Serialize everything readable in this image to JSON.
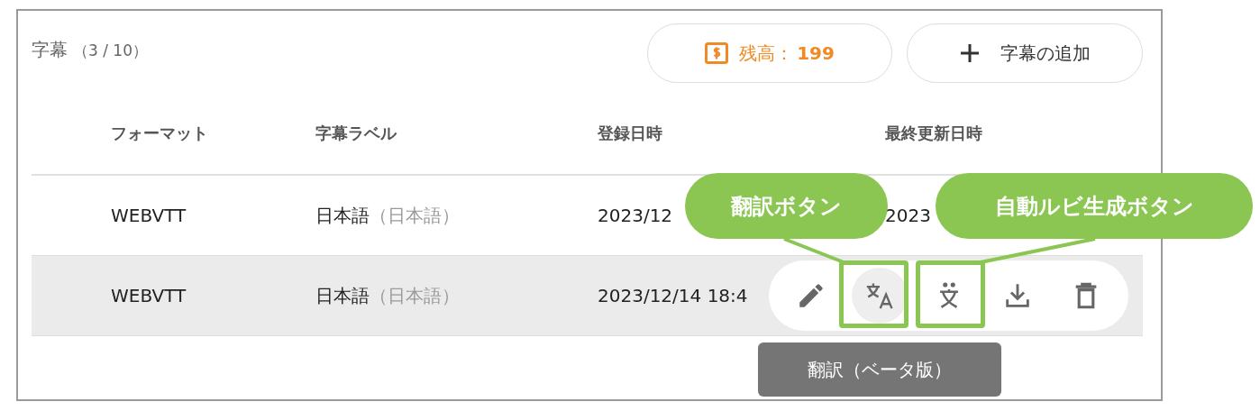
{
  "panel": {
    "title": "字幕",
    "count": "（3 / 10）",
    "balance": {
      "label": "残高：",
      "value": "199"
    },
    "add_button": "字幕の追加"
  },
  "table": {
    "columns": [
      "フォーマット",
      "字幕ラベル",
      "登録日時",
      "最終更新日時"
    ],
    "rows": [
      {
        "format": "WEBVTT",
        "label": "日本語",
        "label_note": "（日本語）",
        "registered": "2023/12",
        "updated": "2023",
        "hovered": false
      },
      {
        "format": "WEBVTT",
        "label": "日本語",
        "label_note": "（日本語）",
        "registered": "2023/12/14 18:4",
        "hovered": true,
        "actions": [
          {
            "kind": "edit",
            "hovered": false
          },
          {
            "kind": "translate",
            "hovered": true
          },
          {
            "kind": "ruby",
            "hovered": false
          },
          {
            "kind": "download",
            "hovered": false
          },
          {
            "kind": "delete",
            "hovered": false
          }
        ],
        "tooltip": "翻訳（ベータ版）"
      }
    ]
  },
  "annotations": [
    {
      "text": "翻訳ボタン"
    },
    {
      "text": "自動ルビ生成ボタン"
    }
  ]
}
